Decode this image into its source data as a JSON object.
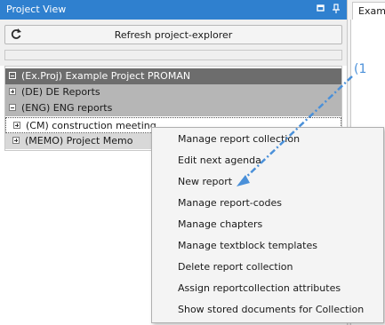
{
  "panel": {
    "title": "Project View",
    "refresh_label": "Refresh project-explorer"
  },
  "tree": {
    "project": "(Ex.Proj) Example Project PROMAN",
    "groups": [
      {
        "label": "(DE) DE Reports",
        "expanded": false
      },
      {
        "label": "(ENG) ENG reports",
        "expanded": true
      }
    ],
    "children": [
      {
        "label": "(CM) construction meeting"
      },
      {
        "label": "(MEMO) Project Memo"
      }
    ]
  },
  "right_tab": {
    "label": "Exampl"
  },
  "context_menu": {
    "items": [
      "Manage report collection",
      "Edit next agenda",
      "New report",
      "Manage report-codes",
      "Manage chapters",
      "Manage textblock templates",
      "Delete report collection",
      "Assign reportcollection attributes",
      "Show stored documents for Collection"
    ]
  },
  "annotation": {
    "label": "(1"
  },
  "colors": {
    "titlebar": "#2f80cf",
    "tree_header": "#6d6d6d",
    "tree_group": "#b6b6b6",
    "annotation": "#4a90d9"
  },
  "icons": [
    "refresh-icon",
    "pin-icon",
    "restore-icon",
    "expander-collapse-icon",
    "expander-expand-icon"
  ]
}
